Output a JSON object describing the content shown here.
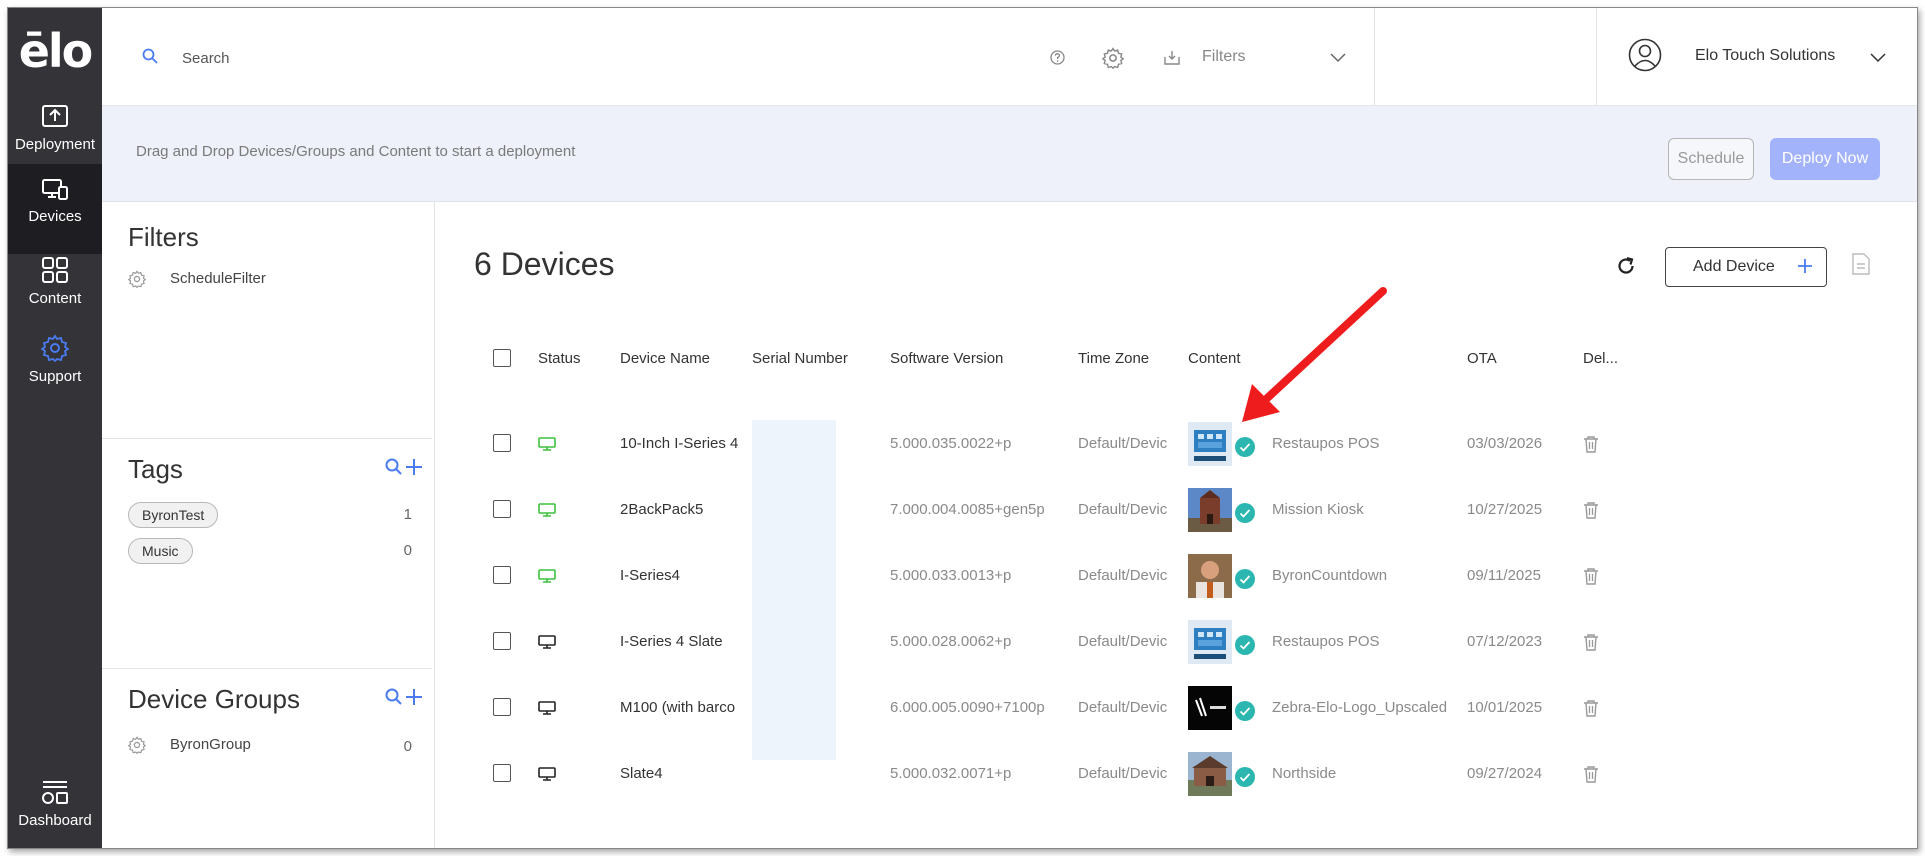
{
  "app": {
    "logo_text": "ēlo",
    "logo_label": "Elo"
  },
  "nav": {
    "items": [
      {
        "id": "deployment",
        "label": "Deployment",
        "icon": "upload-icon",
        "active": false
      },
      {
        "id": "devices",
        "label": "Devices",
        "icon": "devices-icon",
        "active": true
      },
      {
        "id": "content",
        "label": "Content",
        "icon": "grid-icon",
        "active": false
      },
      {
        "id": "support",
        "label": "Support",
        "icon": "gear-icon",
        "active": false,
        "icon_color": "#4a7bf0"
      },
      {
        "id": "dashboard",
        "label": "Dashboard",
        "icon": "dashboard-icon",
        "active": false
      }
    ]
  },
  "topbar": {
    "search_placeholder": "Search",
    "filters_label": "Filters",
    "user_name": "Elo Touch Solutions"
  },
  "deploybar": {
    "hint": "Drag and Drop Devices/Groups and Content to start a deployment",
    "schedule_label": "Schedule",
    "deploy_label": "Deploy Now"
  },
  "sidebar": {
    "filters_title": "Filters",
    "filters": [
      {
        "name": "ScheduleFilter"
      }
    ],
    "tags_title": "Tags",
    "tags": [
      {
        "name": "ByronTest",
        "count": "1"
      },
      {
        "name": "Music",
        "count": "0"
      }
    ],
    "groups_title": "Device Groups",
    "groups": [
      {
        "name": "ByronGroup",
        "count": "0"
      }
    ]
  },
  "main": {
    "title": "6 Devices",
    "add_device_label": "Add Device",
    "columns": [
      "Status",
      "Device Name",
      "Serial Number",
      "Software Version",
      "Time Zone",
      "Content",
      "OTA",
      "Del..."
    ],
    "rows": [
      {
        "status": "online",
        "device_name": "10-Inch I-Series 4",
        "software_version": "5.000.035.0022+p",
        "time_zone": "Default/Devic",
        "content": "Restaupos POS",
        "thumb": "restaupos",
        "ota": "03/03/2026"
      },
      {
        "status": "online",
        "device_name": "2BackPack5",
        "software_version": "7.000.004.0085+gen5p",
        "time_zone": "Default/Devic",
        "content": "Mission Kiosk",
        "thumb": "mission",
        "ota": "10/27/2025"
      },
      {
        "status": "online",
        "device_name": "I-Series4",
        "software_version": "5.000.033.0013+p",
        "time_zone": "Default/Devic",
        "content": "ByronCountdown",
        "thumb": "person",
        "ota": "09/11/2025"
      },
      {
        "status": "offline",
        "device_name": "I-Series 4 Slate",
        "software_version": "5.000.028.0062+p",
        "time_zone": "Default/Devic",
        "content": "Restaupos POS",
        "thumb": "restaupos",
        "ota": "07/12/2023"
      },
      {
        "status": "offline",
        "device_name": "M100 (with barco",
        "software_version": "6.000.005.0090+7100p",
        "time_zone": "Default/Devic",
        "content": "Zebra-Elo-Logo_Upscaled",
        "thumb": "zebra",
        "ota": "10/01/2025"
      },
      {
        "status": "offline",
        "device_name": "Slate4",
        "software_version": "5.000.032.0071+p",
        "time_zone": "Default/Devic",
        "content": "Northside",
        "thumb": "northside",
        "ota": "09/27/2024"
      }
    ]
  },
  "colors": {
    "nav_bg": "#333338",
    "accent": "#4a7bf0",
    "online": "#3cc13c",
    "offline": "#222222",
    "check": "#2bb6b0",
    "annotation_arrow": "#ee1c1c"
  }
}
